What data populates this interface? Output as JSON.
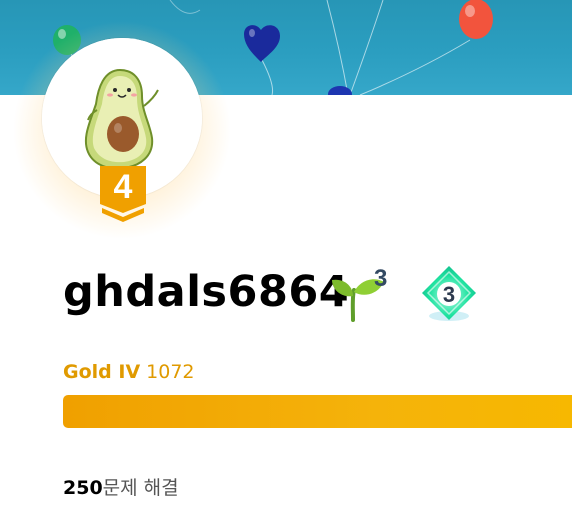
{
  "profile": {
    "username": "ghdals6864",
    "level_badge": "4",
    "class_level": "3",
    "rank_badge": "3"
  },
  "tier": {
    "name": "Gold IV",
    "rating": "1072",
    "progress_fraction": 1.0
  },
  "stats": {
    "solved_count": "250",
    "solved_label": "문제 해결"
  },
  "colors": {
    "banner": "#2b9ec0",
    "gold": "#e09a00",
    "progress": "#f5b30a",
    "level_badge": "#f0a000",
    "rank_badge": "#18d68c"
  },
  "icons": {
    "avatar": "avocado-character",
    "class_badge": "sprout-icon",
    "rank_badge": "diamond-badge-icon"
  }
}
